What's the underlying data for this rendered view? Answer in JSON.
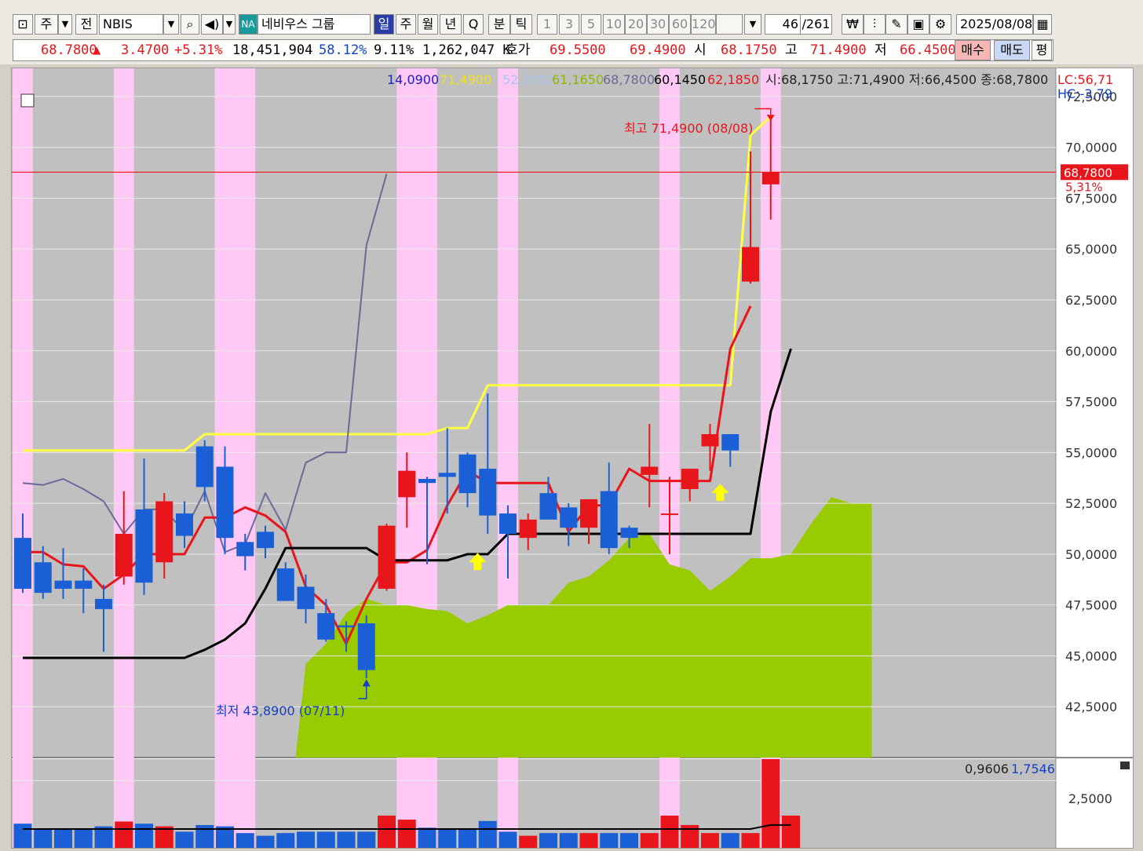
{
  "toolbar": {
    "market": "주",
    "prev": "전",
    "symbol": "NBIS",
    "badge": "NA",
    "name": "네비우스 그룹",
    "periods": [
      "일",
      "주",
      "월",
      "년",
      "Q"
    ],
    "active_period": "일",
    "units": [
      "분",
      "틱"
    ],
    "intervals": [
      "1",
      "3",
      "5",
      "10",
      "20",
      "30",
      "60",
      "120"
    ],
    "count": "46",
    "total": "/261",
    "date": "2025/08/08"
  },
  "quote": {
    "price": "68.7800",
    "arrow": "▲",
    "change": "3.4700",
    "change_pct": "+5.31%",
    "volume": "18,451,904",
    "vol_ratio": "58.12%",
    "turnover": "9.11%",
    "amount": "1,262,047 K",
    "hoga_label": "호가",
    "ask": "69.5500",
    "bid": "69.4900",
    "open_label": "시",
    "open": "68.1750",
    "high_label": "고",
    "high": "71.4900",
    "low_label": "저",
    "low": "66.4500",
    "buy_label": "매수",
    "sell_label": "매도",
    "eval_label": "평"
  },
  "colors": {
    "up": "#e8151b",
    "down": "#1a5fd6",
    "cloud": "#99cc00",
    "pink": "#ffc8f5",
    "plot_bg": "#c0c0c0"
  },
  "chart_data": {
    "type": "candlestick",
    "title": "",
    "legend": {
      "v1": "14,0900",
      "v2": "71,4900",
      "v3": "52,7800",
      "v4": "61,1650",
      "v5": "68,7800",
      "v6": "60,1450",
      "v7": "62,1850",
      "ohlc": "시:68,1750 고:71,4900 저:66,4500 종:68,7800"
    },
    "lc": "LC:56,71",
    "hc": "HC:-3,79",
    "ylim": [
      40.0,
      73.5
    ],
    "yticks": [
      "72,5000",
      "70,0000",
      "67,5000",
      "65,0000",
      "62,5000",
      "60,0000",
      "57,5000",
      "55,0000",
      "52,5000",
      "50,0000",
      "47,5000",
      "45,0000",
      "42,5000"
    ],
    "ytick_values": [
      72.5,
      70,
      67.5,
      65,
      62.5,
      60,
      57.5,
      55,
      52.5,
      50,
      47.5,
      45,
      42.5
    ],
    "price_line": {
      "value": 68.78,
      "label": "68,7800",
      "pct": "5,31%"
    },
    "max_label": "최고 71,4900 (08/08)",
    "min_label": "최저 43,8900 (07/11)",
    "highlight_bars": [
      0,
      5,
      10,
      11,
      19,
      20,
      24,
      32,
      37
    ],
    "candles": [
      [
        50.8,
        52.0,
        48.1,
        48.3
      ],
      [
        49.6,
        50.4,
        47.8,
        48.1
      ],
      [
        48.7,
        50.3,
        47.8,
        48.3
      ],
      [
        48.7,
        49.3,
        47.1,
        48.3
      ],
      [
        47.8,
        48.5,
        45.2,
        47.3
      ],
      [
        48.9,
        53.1,
        48.5,
        51.0
      ],
      [
        52.2,
        54.7,
        48.0,
        48.6
      ],
      [
        49.6,
        53.0,
        48.8,
        52.6
      ],
      [
        52.0,
        52.6,
        50.3,
        50.9
      ],
      [
        55.3,
        55.6,
        52.6,
        53.3
      ],
      [
        54.3,
        55.3,
        50.0,
        50.8
      ],
      [
        50.6,
        51.0,
        49.2,
        49.9
      ],
      [
        51.1,
        51.4,
        49.8,
        50.3
      ],
      [
        49.3,
        49.6,
        47.7,
        47.7
      ],
      [
        48.4,
        49.0,
        46.6,
        47.3
      ],
      [
        47.1,
        47.8,
        45.7,
        45.8
      ],
      [
        46.5,
        46.7,
        45.2,
        46.4
      ],
      [
        46.6,
        47.0,
        43.9,
        44.3
      ],
      [
        48.3,
        51.5,
        48.2,
        51.4
      ],
      [
        52.8,
        55.0,
        51.3,
        54.1
      ],
      [
        53.7,
        53.8,
        49.5,
        53.5
      ],
      [
        54.0,
        56.2,
        52.0,
        53.8
      ],
      [
        54.9,
        55.0,
        52.3,
        53.0
      ],
      [
        54.2,
        57.9,
        51.0,
        51.9
      ],
      [
        52.0,
        52.4,
        48.8,
        51.0
      ],
      [
        50.8,
        52.0,
        50.2,
        51.7
      ],
      [
        53.0,
        53.8,
        51.8,
        51.7
      ],
      [
        52.3,
        52.5,
        50.4,
        51.3
      ],
      [
        51.3,
        52.2,
        50.5,
        52.7
      ],
      [
        53.1,
        54.5,
        50.0,
        50.3
      ],
      [
        51.3,
        51.4,
        50.3,
        50.8
      ],
      [
        53.9,
        56.4,
        52.3,
        54.3
      ],
      [
        52.0,
        53.8,
        50.0,
        52.0
      ],
      [
        53.2,
        53.9,
        52.6,
        54.2
      ],
      [
        55.3,
        56.4,
        54.1,
        55.9
      ],
      [
        55.9,
        55.9,
        54.3,
        55.1
      ],
      [
        63.4,
        69.8,
        63.3,
        65.1
      ],
      [
        68.18,
        71.49,
        66.45,
        68.78
      ]
    ],
    "series": [
      {
        "name": "",
        "color": "#ffff44",
        "values": [
          55.1,
          55.1,
          55.1,
          55.1,
          55.1,
          55.1,
          55.1,
          55.1,
          55.1,
          55.9,
          55.9,
          55.9,
          55.9,
          55.9,
          55.9,
          55.9,
          55.9,
          55.9,
          55.9,
          55.9,
          55.9,
          56.2,
          56.2,
          58.3,
          58.3,
          58.3,
          58.3,
          58.3,
          58.3,
          58.3,
          58.3,
          58.3,
          58.3,
          58.3,
          58.3,
          58.3,
          70.6,
          71.5
        ]
      },
      {
        "name": "",
        "color": "#6a6a9a",
        "values": [
          53.5,
          53.4,
          53.7,
          53.2,
          52.6,
          51.0,
          52.2,
          52.2,
          51.1,
          53.1,
          50.1,
          50.5,
          53.0,
          51.2,
          54.5,
          55.0,
          55.0,
          65.2,
          68.7
        ]
      },
      {
        "name": "",
        "color": "#e8151b",
        "values": [
          50.1,
          50.1,
          49.5,
          49.4,
          48.3,
          49.0,
          50.0,
          50.0,
          50.0,
          51.8,
          51.8,
          52.3,
          51.9,
          51.1,
          48.4,
          47.5,
          45.6,
          47.8,
          49.6,
          49.6,
          50.2,
          52.4,
          54.1,
          53.5,
          53.5,
          53.5,
          53.5,
          51.1,
          52.4,
          52.4,
          54.2,
          53.6,
          53.6,
          53.6,
          53.6,
          60.1,
          62.2
        ]
      },
      {
        "name": "",
        "color": "#000000",
        "values": [
          44.9,
          44.9,
          44.9,
          44.9,
          44.9,
          44.9,
          44.9,
          44.9,
          44.9,
          45.3,
          45.8,
          46.6,
          48.3,
          50.3,
          50.3,
          50.3,
          50.3,
          50.3,
          49.7,
          49.7,
          49.7,
          49.7,
          50.0,
          50.0,
          51.0,
          51.0,
          51.0,
          51.0,
          51.0,
          51.0,
          51.0,
          51.0,
          51.0,
          51.0,
          51.0,
          51.0,
          51.0,
          57.0,
          60.1
        ]
      }
    ],
    "cloud": [
      [
        13.5,
        40.0
      ],
      [
        14.0,
        44.6
      ],
      [
        15.0,
        45.6
      ],
      [
        16.0,
        47.1
      ],
      [
        17.0,
        47.8
      ],
      [
        18.0,
        47.5
      ],
      [
        19.0,
        47.5
      ],
      [
        20.0,
        47.3
      ],
      [
        21.0,
        47.2
      ],
      [
        22.0,
        46.6
      ],
      [
        23.0,
        47.0
      ],
      [
        24.0,
        47.5
      ],
      [
        25.0,
        47.5
      ],
      [
        26.0,
        47.5
      ],
      [
        27.0,
        48.6
      ],
      [
        28.0,
        48.9
      ],
      [
        29.0,
        49.7
      ],
      [
        30.0,
        50.8
      ],
      [
        31.0,
        51.0
      ],
      [
        32.0,
        49.5
      ],
      [
        33.0,
        49.2
      ],
      [
        34.0,
        48.2
      ],
      [
        35.0,
        48.9
      ],
      [
        36.0,
        49.8
      ],
      [
        37.0,
        49.8
      ],
      [
        38.0,
        50.0
      ],
      [
        39.0,
        51.5
      ],
      [
        40.0,
        52.8
      ],
      [
        41.0,
        52.5
      ],
      [
        42.0,
        52.5
      ],
      [
        42.0,
        40.0
      ]
    ],
    "volume_label_1": "0,9606",
    "volume_label_2": "1,7546",
    "volume_tick": "2,5000",
    "volume_ylim": [
      0,
      3.3
    ],
    "volume": [
      0.9,
      0.7,
      0.7,
      0.7,
      0.8,
      0.98,
      0.9,
      0.8,
      0.6,
      0.85,
      0.8,
      0.55,
      0.45,
      0.55,
      0.6,
      0.6,
      0.6,
      0.6,
      1.2,
      1.05,
      0.75,
      0.7,
      0.7,
      1.0,
      0.6,
      0.45,
      0.55,
      0.55,
      0.55,
      0.55,
      0.55,
      0.55,
      1.2,
      0.85,
      0.55,
      0.55,
      0.55,
      3.6,
      1.2
    ]
  }
}
